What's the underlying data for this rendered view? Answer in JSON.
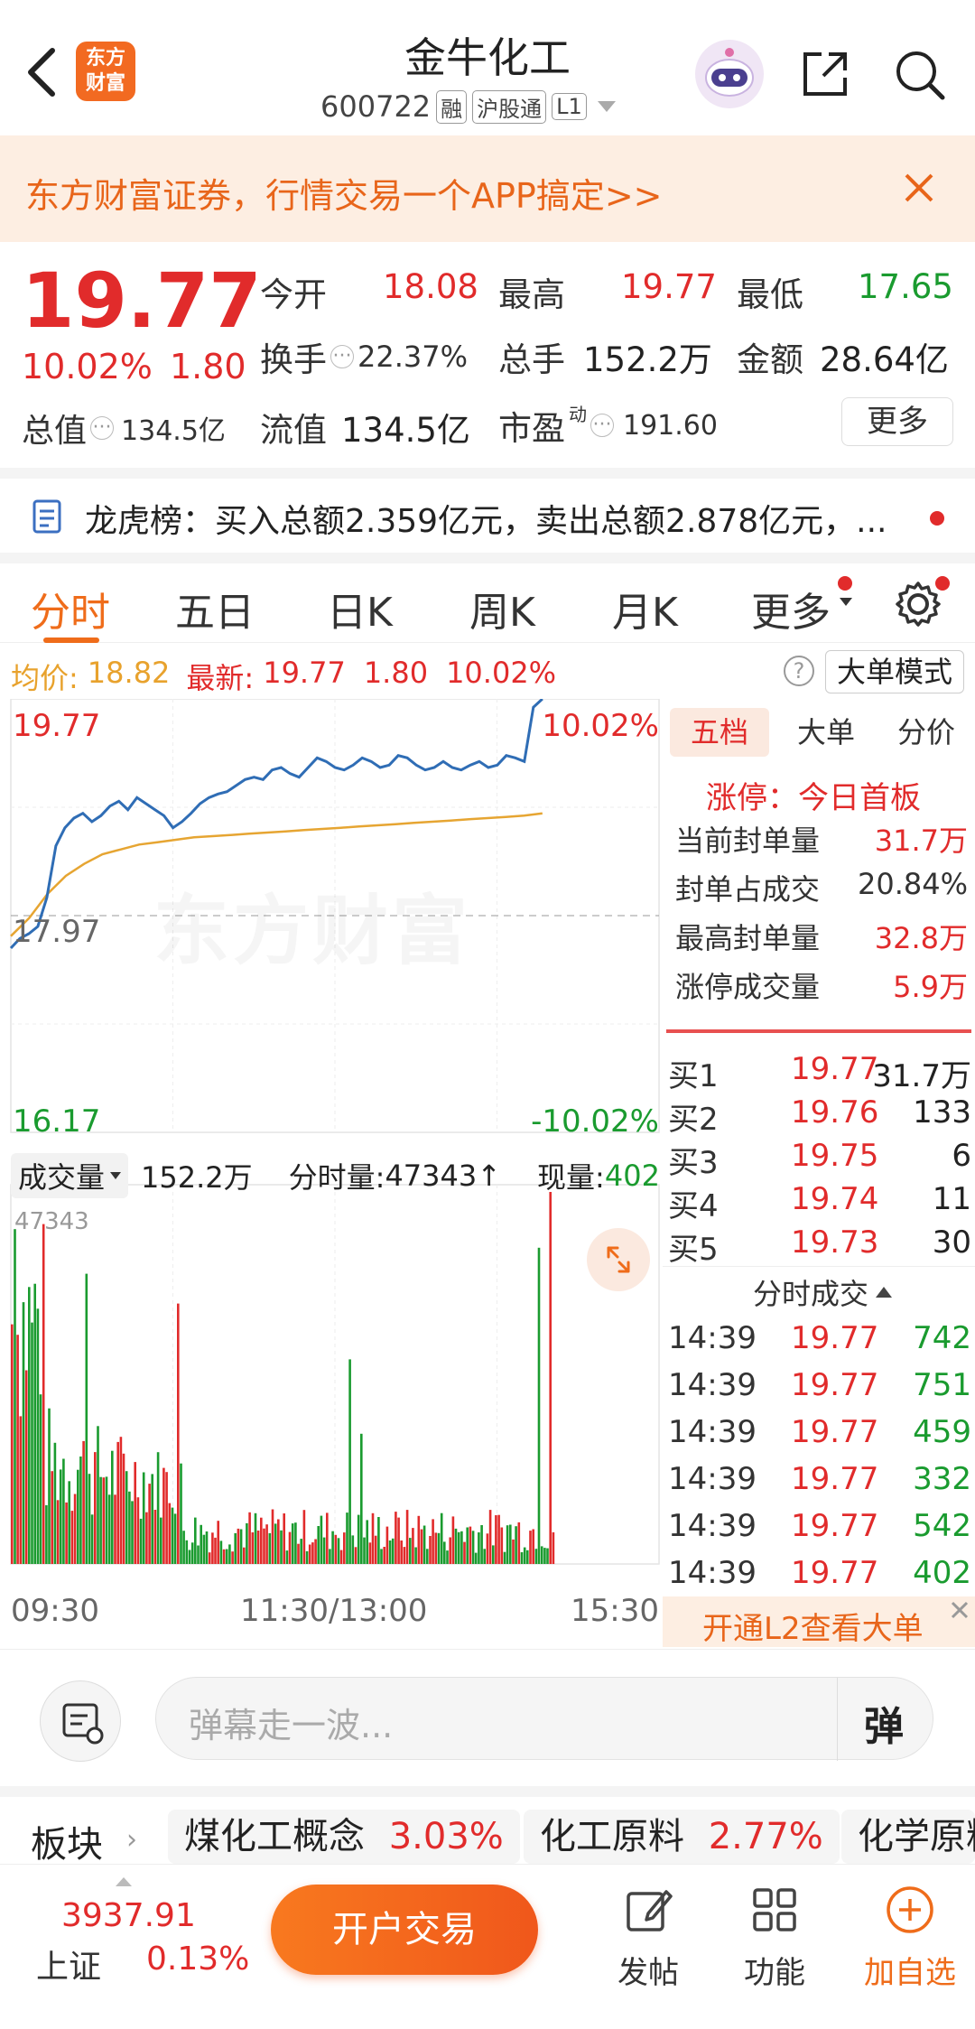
{
  "header": {
    "title": "金牛化工",
    "code": "600722",
    "badges": [
      "融",
      "沪股通",
      "L1"
    ],
    "logo_line1": "东方",
    "logo_line2": "财富"
  },
  "banner": {
    "text": "东方财富证券，行情交易一个APP搞定>>"
  },
  "quote": {
    "price": "19.77",
    "change_pct": "10.02%",
    "change": "1.80",
    "open_label": "今开",
    "open": "18.08",
    "high_label": "最高",
    "high": "19.77",
    "low_label": "最低",
    "low": "17.65",
    "turnover_label": "换手",
    "turnover": "22.37%",
    "volume_label": "总手",
    "volume": "152.2万",
    "amount_label": "金额",
    "amount": "28.64亿",
    "mktcap_label": "总值",
    "mktcap": "134.5亿",
    "float_label": "流值",
    "float": "134.5亿",
    "pe_label": "市盈",
    "pe_sup": "动",
    "pe": "191.60",
    "more_button": "更多"
  },
  "lhb": {
    "text": "龙虎榜：买入总额2.359亿元，卖出总额2.878亿元，..."
  },
  "tabs": [
    "分时",
    "五日",
    "日K",
    "周K",
    "月K",
    "更多"
  ],
  "avgbar": {
    "avg_label": "均价:",
    "avg": "18.82",
    "latest_label": "最新:",
    "latest": "19.77",
    "change": "1.80",
    "change_pct": "10.02%",
    "mode_button": "大单模式"
  },
  "chart_data": {
    "type": "line",
    "price_top": "19.77",
    "price_mid": "17.97",
    "price_bottom": "16.17",
    "pct_top": "10.02%",
    "pct_bottom": "-10.02%",
    "ylim": [
      16.17,
      19.77
    ],
    "watermark": "东方财富",
    "time_labels": [
      "09:30",
      "11:30/13:00",
      "15:30"
    ],
    "volume_info": {
      "label": "成交量",
      "total": "152.2万",
      "minute_label": "分时量:",
      "minute": "47343↑",
      "current_label": "现量:",
      "current": "402",
      "max": "47343"
    },
    "price_series": [
      17.7,
      17.78,
      17.82,
      17.88,
      18.12,
      18.55,
      18.7,
      18.78,
      18.82,
      18.75,
      18.8,
      18.88,
      18.92,
      18.85,
      18.95,
      18.9,
      18.85,
      18.8,
      18.7,
      18.75,
      18.82,
      18.9,
      18.95,
      18.98,
      19.0,
      19.05,
      19.1,
      19.12,
      19.1,
      19.18,
      19.2,
      19.15,
      19.12,
      19.2,
      19.28,
      19.25,
      19.2,
      19.18,
      19.22,
      19.28,
      19.25,
      19.2,
      19.22,
      19.3,
      19.28,
      19.22,
      19.18,
      19.2,
      19.25,
      19.2,
      19.18,
      19.22,
      19.25,
      19.2,
      19.22,
      19.3,
      19.28,
      19.25,
      19.7,
      19.77
    ],
    "avg_series": [
      17.8,
      17.95,
      18.15,
      18.3,
      18.4,
      18.48,
      18.52,
      18.56,
      18.58,
      18.6,
      18.62,
      18.63,
      18.64,
      18.65,
      18.66,
      18.67,
      18.68,
      18.69,
      18.7,
      18.71,
      18.72,
      18.73,
      18.74,
      18.75,
      18.76,
      18.77,
      18.78,
      18.79,
      18.8,
      18.82
    ]
  },
  "rpanel": {
    "tabs": [
      "五档",
      "大单",
      "分价"
    ],
    "limit_title": "涨停：今日首板",
    "limit_rows": [
      {
        "label": "当前封单量",
        "value": "31.7万"
      },
      {
        "label": "封单占成交",
        "value": "20.84%"
      },
      {
        "label": "最高封单量",
        "value": "32.8万"
      },
      {
        "label": "涨停成交量",
        "value": "5.9万"
      }
    ],
    "bids": [
      {
        "label": "买1",
        "price": "19.77",
        "vol": "31.7万"
      },
      {
        "label": "买2",
        "price": "19.76",
        "vol": "133"
      },
      {
        "label": "买3",
        "price": "19.75",
        "vol": "6"
      },
      {
        "label": "买4",
        "price": "19.74",
        "vol": "11"
      },
      {
        "label": "买5",
        "price": "19.73",
        "vol": "30"
      }
    ],
    "trades_title": "分时成交",
    "trades": [
      {
        "time": "14:39",
        "price": "19.77",
        "vol": "742"
      },
      {
        "time": "14:39",
        "price": "19.77",
        "vol": "751"
      },
      {
        "time": "14:39",
        "price": "19.77",
        "vol": "459"
      },
      {
        "time": "14:39",
        "price": "19.77",
        "vol": "332"
      },
      {
        "time": "14:39",
        "price": "19.77",
        "vol": "542"
      },
      {
        "time": "14:39",
        "price": "19.77",
        "vol": "402"
      }
    ],
    "l2_banner": "开通L2查看大单"
  },
  "danmu": {
    "placeholder": "弹幕走一波...",
    "send_label": "弹"
  },
  "sector": {
    "label": "板块",
    "items": [
      {
        "name": "煤化工概念",
        "pct": "3.03%"
      },
      {
        "name": "化工原料",
        "pct": "2.77%"
      },
      {
        "name": "化学原料",
        "pct": ""
      }
    ]
  },
  "bottom": {
    "index_value": "3937.91",
    "index_name": "上证",
    "index_pct": "0.13%",
    "open_account": "开户交易",
    "post": "发帖",
    "function": "功能",
    "add_watch": "加自选"
  },
  "colors": {
    "up": "#e12b2b",
    "down": "#1a9b2f",
    "accent": "#ef6c1a",
    "line": "#2f6db5",
    "avg": "#e6a532"
  }
}
